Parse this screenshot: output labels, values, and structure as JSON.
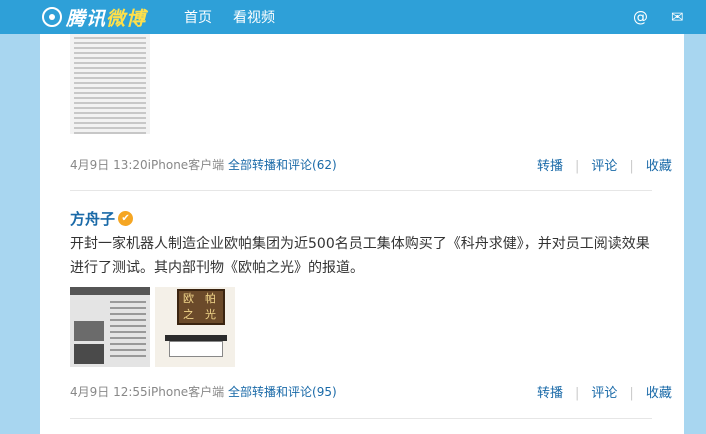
{
  "header": {
    "logo_text_a": "腾讯",
    "logo_text_b": "微博",
    "nav": [
      "首页",
      "看视频"
    ],
    "icons": [
      "at-icon",
      "mail-icon"
    ]
  },
  "posts": [
    {
      "date": "4月9日 13:20",
      "source": "iPhone客户端",
      "forward_comments": "全部转播和评论",
      "count": "(62)",
      "actions": [
        "转播",
        "评论",
        "收藏"
      ]
    },
    {
      "author": "方舟子",
      "verified_icon": "vip-badge-icon",
      "text": "开封一家机器人制造企业欧帕集团为近500名员工集体购买了《科舟求健》，并对员工阅读效果进行了测试。其内部刊物《欧帕之光》的报道。",
      "banner_chars": [
        "欧",
        "帕",
        "之",
        "光"
      ],
      "date": "4月9日 12:55",
      "source": "iPhone客户端",
      "forward_comments": "全部转播和评论",
      "count": "(95)",
      "actions": [
        "转播",
        "评论",
        "收藏"
      ]
    }
  ]
}
